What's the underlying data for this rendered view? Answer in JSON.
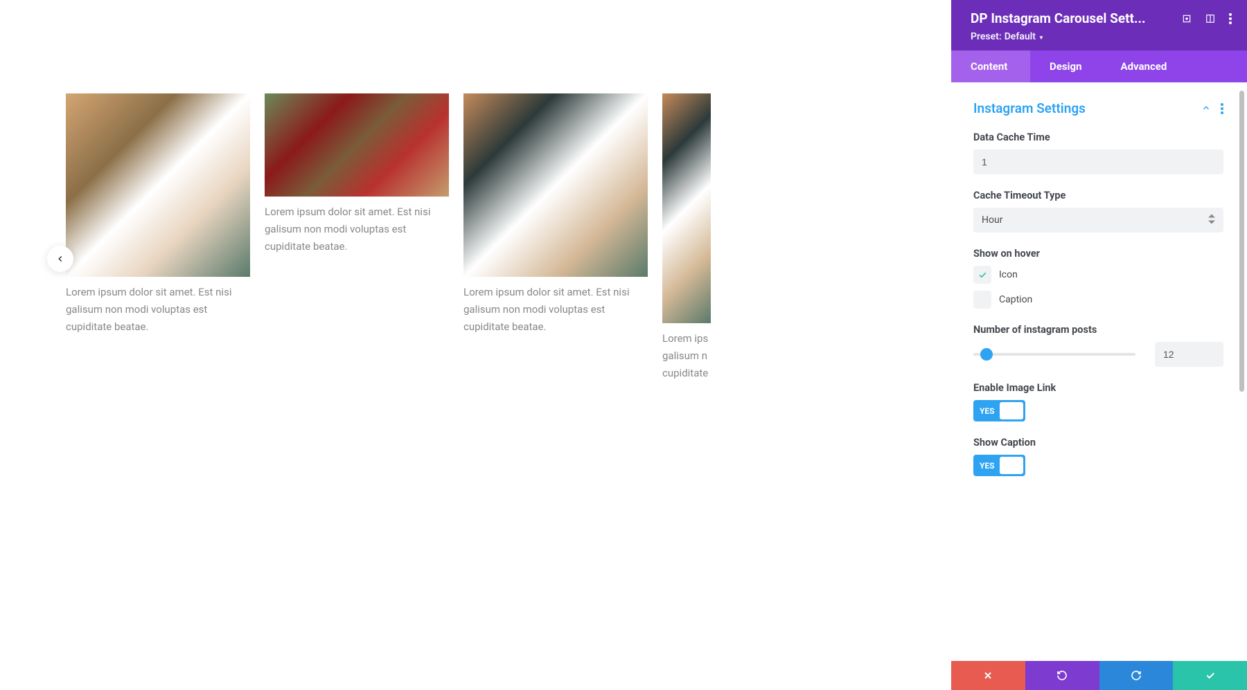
{
  "header": {
    "title": "DP Instagram Carousel Sett...",
    "preset_label": "Preset:",
    "preset_value": "Default"
  },
  "tabs": {
    "content": "Content",
    "design": "Design",
    "advanced": "Advanced"
  },
  "section": {
    "title": "Instagram Settings"
  },
  "fields": {
    "data_cache_time_label": "Data Cache Time",
    "data_cache_time_value": "1",
    "cache_timeout_type_label": "Cache Timeout Type",
    "cache_timeout_type_value": "Hour",
    "show_on_hover_label": "Show on hover",
    "check_icon_label": "Icon",
    "check_caption_label": "Caption",
    "num_posts_label": "Number of instagram posts",
    "num_posts_value": "12",
    "enable_image_link_label": "Enable Image Link",
    "show_caption_label": "Show Caption",
    "toggle_yes": "YES"
  },
  "carousel": {
    "caption1": "Lorem ipsum dolor sit amet. Est nisi galisum non modi voluptas est cupiditate beatae.",
    "caption2": "Lorem ipsum dolor sit amet. Est nisi galisum non modi voluptas est cupiditate beatae.",
    "caption3": "Lorem ipsum dolor sit amet. Est nisi galisum non modi voluptas est cupiditate beatae.",
    "caption4_a": "Lorem ips",
    "caption4_b": "galisum n",
    "caption4_c": "cupiditate"
  }
}
